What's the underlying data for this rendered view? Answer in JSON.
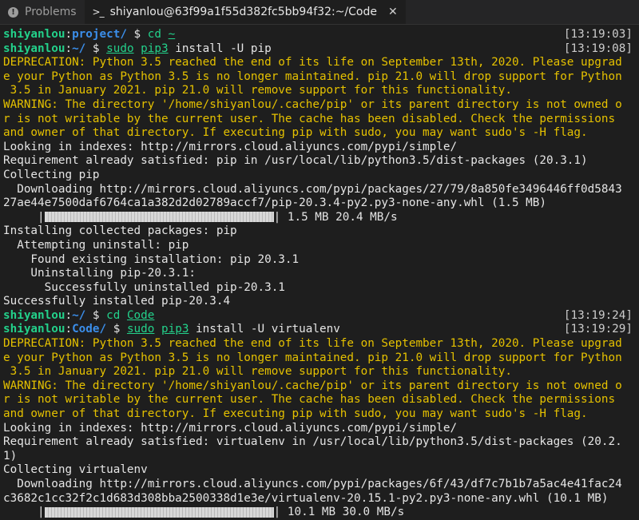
{
  "tabs": [
    {
      "label": "Problems",
      "icon": "problems-icon",
      "active": false
    },
    {
      "label": "shiyanlou@63f99a1f55d382fc5bb94f32:~/Code",
      "icon": "terminal-icon",
      "active": true
    }
  ],
  "terminal": {
    "lines": [
      {
        "kind": "prompt",
        "user": "shiyanlou",
        "path": "project/",
        "segments": [
          {
            "t": "cmd",
            "v": "cd"
          },
          {
            "t": "plain",
            "v": " "
          },
          {
            "t": "cmdu",
            "v": "~"
          }
        ],
        "ts": "[13:19:03]"
      },
      {
        "kind": "prompt",
        "user": "shiyanlou",
        "path": "~/",
        "segments": [
          {
            "t": "cmdu",
            "v": "sudo"
          },
          {
            "t": "plain",
            "v": " "
          },
          {
            "t": "cmdu",
            "v": "pip3"
          },
          {
            "t": "plain",
            "v": " install -U pip"
          }
        ],
        "ts": "[13:19:08]"
      },
      {
        "kind": "warn",
        "text": "DEPRECATION: Python 3.5 reached the end of its life on September 13th, 2020. Please upgrad"
      },
      {
        "kind": "warn",
        "text": "e your Python as Python 3.5 is no longer maintained. pip 21.0 will drop support for Python"
      },
      {
        "kind": "warn",
        "text": " 3.5 in January 2021. pip 21.0 will remove support for this functionality."
      },
      {
        "kind": "warn",
        "text": "WARNING: The directory '/home/shiyanlou/.cache/pip' or its parent directory is not owned o"
      },
      {
        "kind": "warn",
        "text": "r is not writable by the current user. The cache has been disabled. Check the permissions"
      },
      {
        "kind": "warn",
        "text": "and owner of that directory. If executing pip with sudo, you may want sudo's -H flag."
      },
      {
        "kind": "plain",
        "text": "Looking in indexes: http://mirrors.cloud.aliyuncs.com/pypi/simple/"
      },
      {
        "kind": "plain",
        "text": "Requirement already satisfied: pip in /usr/local/lib/python3.5/dist-packages (20.3.1)"
      },
      {
        "kind": "plain",
        "text": "Collecting pip"
      },
      {
        "kind": "plain",
        "text": "  Downloading http://mirrors.cloud.aliyuncs.com/pypi/packages/27/79/8a850fe3496446ff0d5843"
      },
      {
        "kind": "plain",
        "text": "27ae44e7500daf6764ca1a382d2d02789accf7/pip-20.3.4-py2.py3-none-any.whl (1.5 MB)"
      },
      {
        "kind": "progress",
        "prefix": "     |",
        "suffix": "| 1.5 MB 20.4 MB/s",
        "fraction": 1.0
      },
      {
        "kind": "plain",
        "text": "Installing collected packages: pip"
      },
      {
        "kind": "plain",
        "text": "  Attempting uninstall: pip"
      },
      {
        "kind": "plain",
        "text": "    Found existing installation: pip 20.3.1"
      },
      {
        "kind": "plain",
        "text": "    Uninstalling pip-20.3.1:"
      },
      {
        "kind": "plain",
        "text": "      Successfully uninstalled pip-20.3.1"
      },
      {
        "kind": "plain",
        "text": "Successfully installed pip-20.3.4"
      },
      {
        "kind": "prompt",
        "user": "shiyanlou",
        "path": "~/",
        "segments": [
          {
            "t": "cmd",
            "v": "cd"
          },
          {
            "t": "plain",
            "v": " "
          },
          {
            "t": "cmdu",
            "v": "Code"
          }
        ],
        "ts": "[13:19:24]"
      },
      {
        "kind": "prompt",
        "user": "shiyanlou",
        "path": "Code/",
        "segments": [
          {
            "t": "cmdu",
            "v": "sudo"
          },
          {
            "t": "plain",
            "v": " "
          },
          {
            "t": "cmdu",
            "v": "pip3"
          },
          {
            "t": "plain",
            "v": " install -U virtualenv"
          }
        ],
        "ts": "[13:19:29]"
      },
      {
        "kind": "warn",
        "text": "DEPRECATION: Python 3.5 reached the end of its life on September 13th, 2020. Please upgrad"
      },
      {
        "kind": "warn",
        "text": "e your Python as Python 3.5 is no longer maintained. pip 21.0 will drop support for Python"
      },
      {
        "kind": "warn",
        "text": " 3.5 in January 2021. pip 21.0 will remove support for this functionality."
      },
      {
        "kind": "warn",
        "text": "WARNING: The directory '/home/shiyanlou/.cache/pip' or its parent directory is not owned o"
      },
      {
        "kind": "warn",
        "text": "r is not writable by the current user. The cache has been disabled. Check the permissions"
      },
      {
        "kind": "warn",
        "text": "and owner of that directory. If executing pip with sudo, you may want sudo's -H flag."
      },
      {
        "kind": "plain",
        "text": "Looking in indexes: http://mirrors.cloud.aliyuncs.com/pypi/simple/"
      },
      {
        "kind": "plain",
        "text": "Requirement already satisfied: virtualenv in /usr/local/lib/python3.5/dist-packages (20.2."
      },
      {
        "kind": "plain",
        "text": "1)"
      },
      {
        "kind": "plain",
        "text": "Collecting virtualenv"
      },
      {
        "kind": "plain",
        "text": "  Downloading http://mirrors.cloud.aliyuncs.com/pypi/packages/6f/43/df7c7b1b7a5ac4e41fac24"
      },
      {
        "kind": "plain",
        "text": "c3682c1cc32f2c1d683d308bba2500338d1e3e/virtualenv-20.15.1-py2.py3-none-any.whl (10.1 MB)"
      },
      {
        "kind": "progress",
        "prefix": "     |",
        "suffix": "| 10.1 MB 30.0 MB/s",
        "fraction": 1.0
      }
    ]
  }
}
